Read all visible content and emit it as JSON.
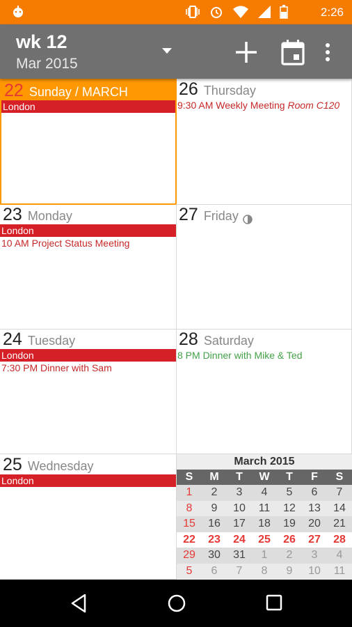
{
  "status": {
    "time": "2:26"
  },
  "appbar": {
    "week": "wk 12",
    "month": "Mar 2015"
  },
  "days": [
    {
      "num": "22",
      "name": "Sunday / MARCH",
      "bar": "London",
      "events": []
    },
    {
      "num": "23",
      "name": "Monday",
      "bar": "London",
      "events": [
        {
          "text": "10 AM Project Status Meeting",
          "color": "red"
        }
      ]
    },
    {
      "num": "24",
      "name": "Tuesday",
      "bar": "London",
      "events": [
        {
          "text": "7:30 PM Dinner with Sam",
          "color": "red"
        }
      ]
    },
    {
      "num": "25",
      "name": "Wednesday",
      "bar": "London",
      "events": []
    },
    {
      "num": "26",
      "name": "Thursday",
      "events": [
        {
          "text": "9:30 AM Weekly Meeting",
          "loc": "Room C120",
          "color": "red"
        }
      ]
    },
    {
      "num": "27",
      "name": "Friday",
      "events": []
    },
    {
      "num": "28",
      "name": "Saturday",
      "events": [
        {
          "text": "8 PM Dinner with Mike & Ted",
          "color": "green"
        }
      ]
    }
  ],
  "mini": {
    "title": "March 2015",
    "weekdays": [
      "S",
      "M",
      "T",
      "W",
      "T",
      "F",
      "S"
    ],
    "weeks": [
      [
        "1",
        "2",
        "3",
        "4",
        "5",
        "6",
        "7"
      ],
      [
        "8",
        "9",
        "10",
        "11",
        "12",
        "13",
        "14"
      ],
      [
        "15",
        "16",
        "17",
        "18",
        "19",
        "20",
        "21"
      ],
      [
        "22",
        "23",
        "24",
        "25",
        "26",
        "27",
        "28"
      ],
      [
        "29",
        "30",
        "31",
        "1",
        "2",
        "3",
        "4"
      ],
      [
        "5",
        "6",
        "7",
        "8",
        "9",
        "10",
        "11"
      ]
    ]
  },
  "colors": {
    "accent": "#ff9800",
    "statusbar": "#f57c00",
    "appbar": "#707070",
    "london": "#d62027"
  }
}
